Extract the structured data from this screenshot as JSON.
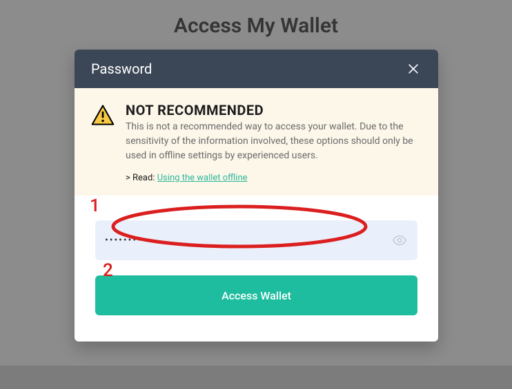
{
  "page": {
    "title": "Access My Wallet"
  },
  "modal": {
    "title": "Password",
    "warning": {
      "heading": "NOT RECOMMENDED",
      "description": "This is not a recommended way to access your wallet. Due to the sensitivity of the information involved, these options should only be used in offline settings by experienced users.",
      "read_prefix": "> Read: ",
      "read_link_text": "Using the wallet offline"
    },
    "password": {
      "value": "•••••••••",
      "placeholder": ""
    },
    "action_button_label": "Access Wallet"
  },
  "annotations": {
    "label1": "1",
    "label2": "2"
  }
}
